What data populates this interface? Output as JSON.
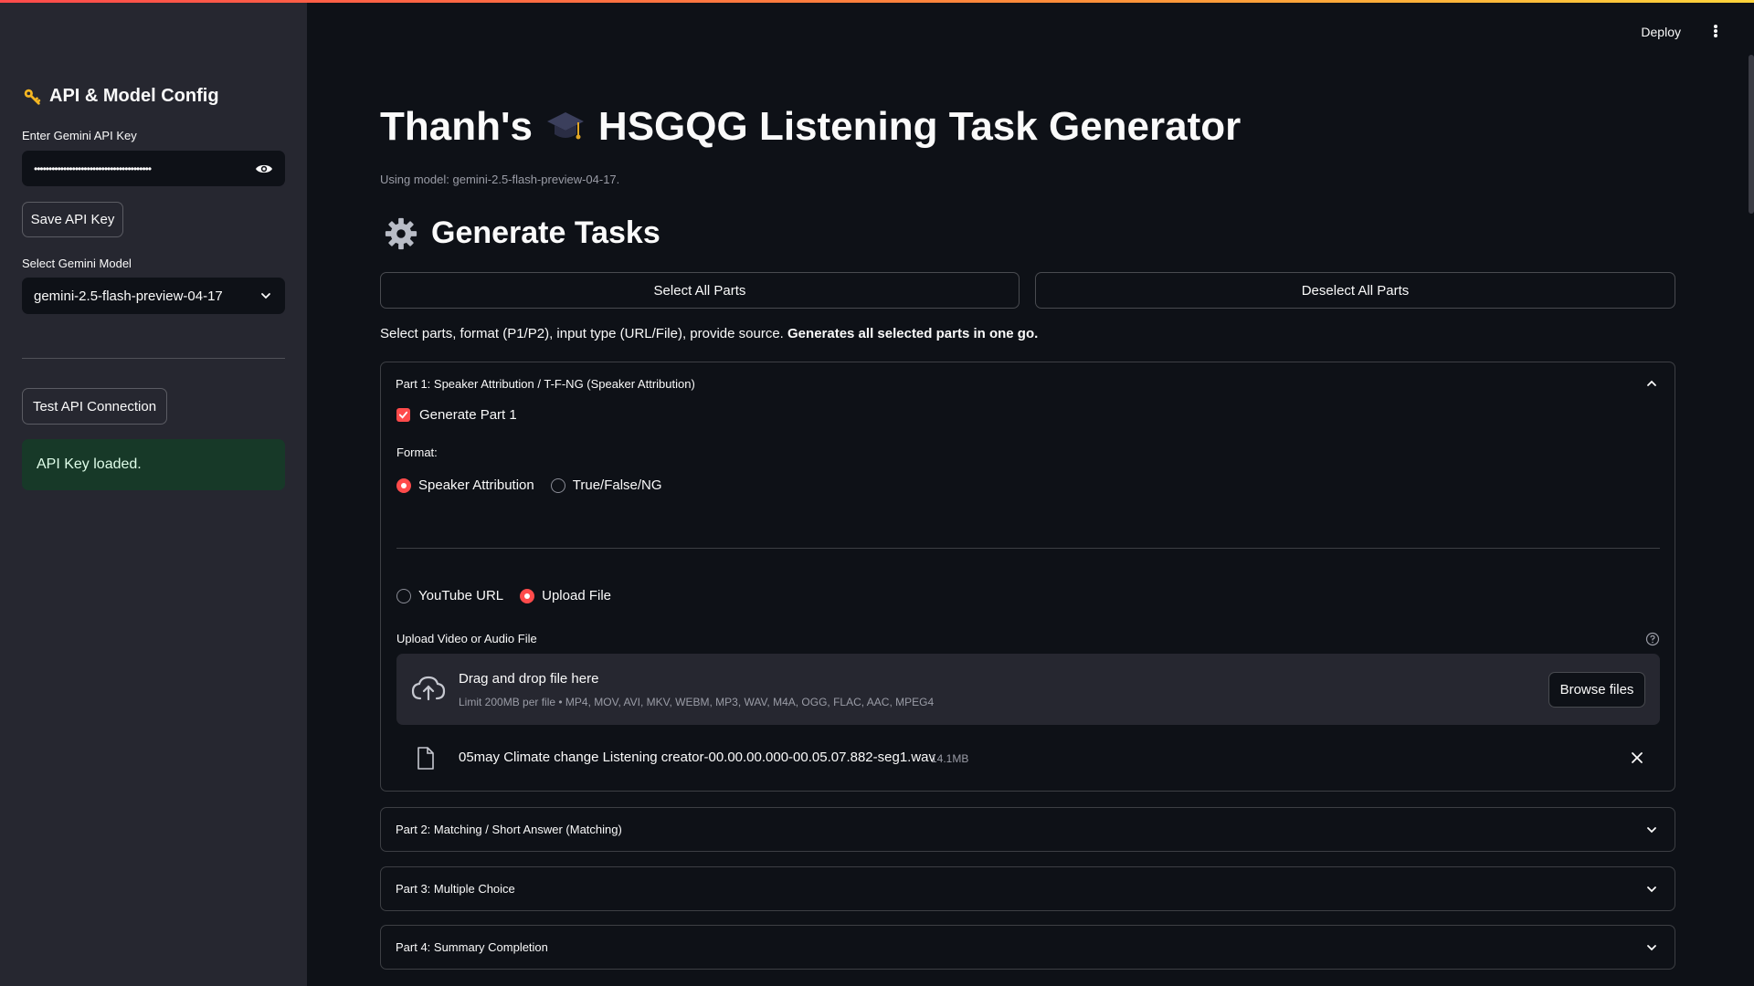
{
  "sidebar": {
    "title": "API & Model Config",
    "api_key_label": "Enter Gemini API Key",
    "api_key_value": "••••••••••••••••••••••••••••••••••••••••",
    "save_button": "Save API Key",
    "model_label": "Select Gemini Model",
    "model_value": "gemini-2.5-flash-preview-04-17",
    "test_button": "Test API Connection",
    "status_message": "API Key loaded."
  },
  "header": {
    "deploy": "Deploy"
  },
  "main": {
    "title_before": "Thanh's",
    "title_after": "HSGQG Listening Task Generator",
    "caption": "Using model: gemini-2.5-flash-preview-04-17.",
    "section_title": "Generate Tasks",
    "select_all": "Select All Parts",
    "deselect_all": "Deselect All Parts",
    "description": "Select parts, format (P1/P2), input type (URL/File), provide source. ",
    "description_bold": "Generates all selected parts in one go.",
    "part1": {
      "header": "Part 1: Speaker Attribution / T-F-NG (Speaker Attribution)",
      "generate_label": "Generate Part 1",
      "generate_checked": true,
      "format_label": "Format:",
      "format_options": [
        "Speaker Attribution",
        "True/False/NG"
      ],
      "format_selected": "Speaker Attribution",
      "input_options": [
        "YouTube URL",
        "Upload File"
      ],
      "input_selected": "Upload File",
      "upload_label": "Upload Video or Audio File",
      "dropzone_title": "Drag and drop file here",
      "dropzone_limit": "Limit 200MB per file • MP4, MOV, AVI, MKV, WEBM, MP3, WAV, M4A, OGG, FLAC, AAC, MPEG4",
      "browse_button": "Browse files",
      "file_name": "05may Climate change Listening creator-00.00.00.000-00.05.07.882-seg1.wav",
      "file_size": "14.1MB"
    },
    "part2_header": "Part 2: Matching / Short Answer (Matching)",
    "part3_header": "Part 3: Multiple Choice",
    "part4_header": "Part 4: Summary Completion"
  },
  "colors": {
    "accent": "#ff4b4b",
    "background": "#0e1117",
    "sidebar": "#262730",
    "success_bg": "#173928"
  },
  "icons": {
    "sidebar_title": "key-icon",
    "title_emoji": "graduation-cap-icon",
    "section": "gear-icon"
  }
}
